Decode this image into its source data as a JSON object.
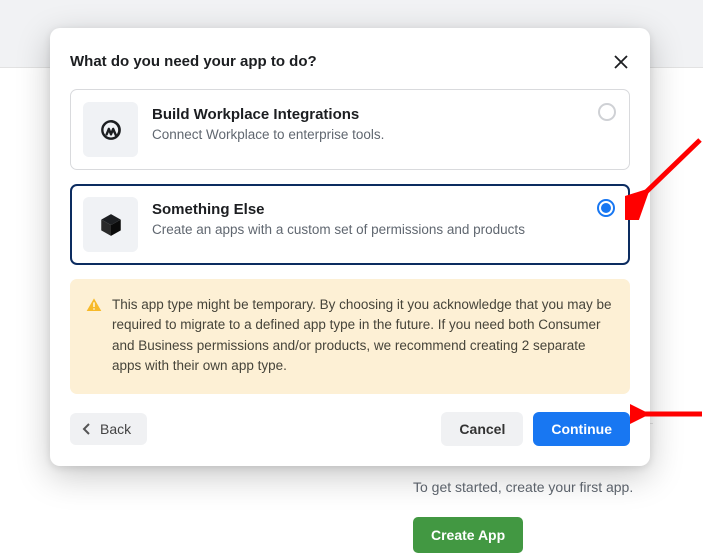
{
  "page": {
    "get_started_text": "To get started, create your first app.",
    "create_app_label": "Create App"
  },
  "modal": {
    "title": "What do you need your app to do?",
    "options": [
      {
        "title": "Build Workplace Integrations",
        "description": "Connect Workplace to enterprise tools.",
        "icon": "workplace",
        "selected": false
      },
      {
        "title": "Something Else",
        "description": "Create an apps with a custom set of permissions and products",
        "icon": "cube",
        "selected": true
      }
    ],
    "warning": "This app type might be temporary. By choosing it you acknowledge that you may be required to migrate to a defined app type in the future. If you need both Consumer and Business permissions and/or products, we recommend creating 2 separate apps with their own app type.",
    "back_label": "Back",
    "cancel_label": "Cancel",
    "continue_label": "Continue"
  }
}
